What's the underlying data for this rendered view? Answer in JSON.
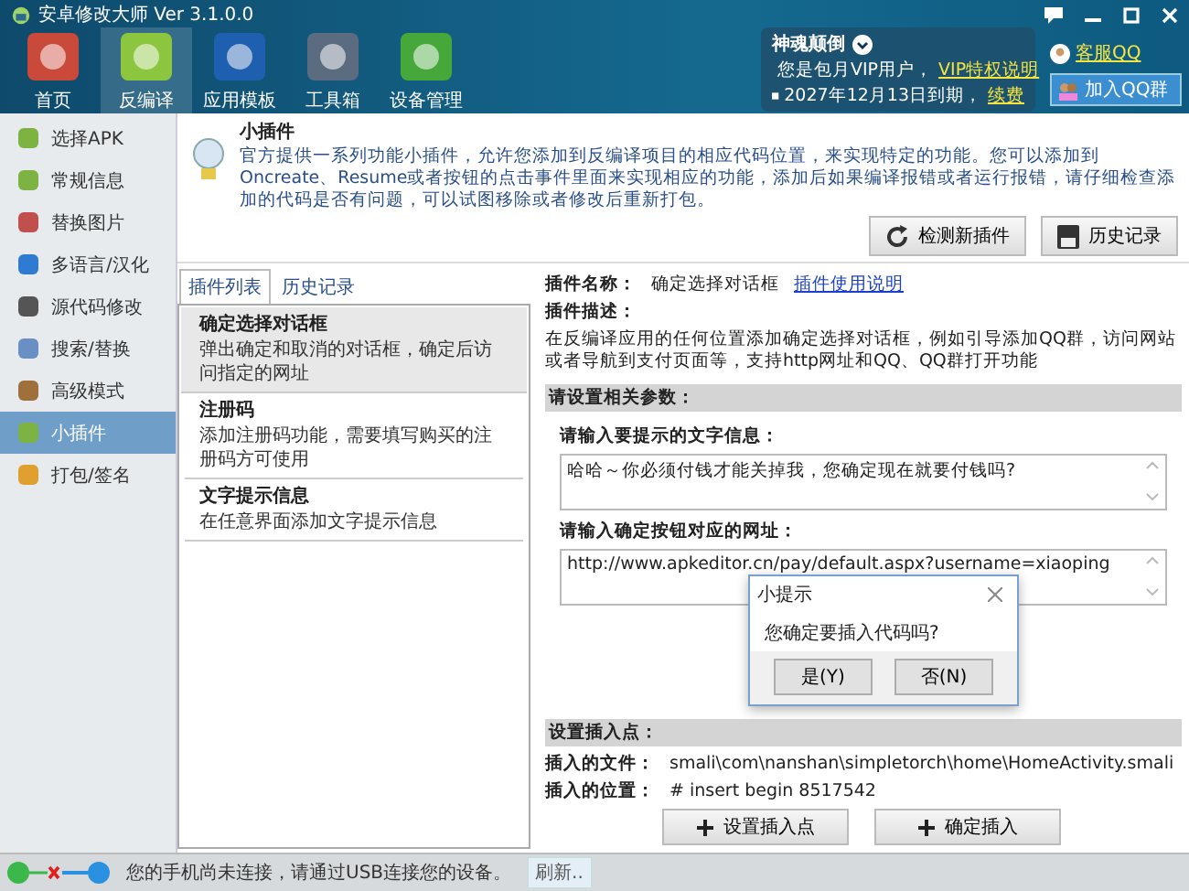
{
  "window": {
    "title": "安卓修改大师 Ver 3.1.0.0"
  },
  "toolbar": [
    {
      "label": "首页",
      "selected": false
    },
    {
      "label": "反编译",
      "selected": true
    },
    {
      "label": "应用模板",
      "selected": false
    },
    {
      "label": "工具箱",
      "selected": false
    },
    {
      "label": "设备管理",
      "selected": false
    }
  ],
  "account": {
    "name": "神魂颠倒",
    "line_1": "您是包月VIP用户，",
    "link_1": "VIP特权说明",
    "line_2": "2027年12月13日到期，",
    "link_2": "续费",
    "support_link": "客服QQ",
    "group_button": "加入QQ群"
  },
  "sidebar": [
    {
      "label": "选择APK",
      "selected": false
    },
    {
      "label": "常规信息",
      "selected": false
    },
    {
      "label": "替换图片",
      "selected": false
    },
    {
      "label": "多语言/汉化",
      "selected": false
    },
    {
      "label": "源代码修改",
      "selected": false
    },
    {
      "label": "搜索/替换",
      "selected": false
    },
    {
      "label": "高级模式",
      "selected": false
    },
    {
      "label": "小插件",
      "selected": true
    },
    {
      "label": "打包/签名",
      "selected": false
    }
  ],
  "header": {
    "title": "小插件",
    "description": "官方提供一系列功能小插件，允许您添加到反编译项目的相应代码位置，来实现特定的功能。您可以添加到Oncreate、Resume或者按钮的点击事件里面来实现相应的功能，添加后如果编译报错或者运行报错，请仔细检查添加的代码是否有问题，可以试图移除或者修改后重新打包。"
  },
  "actions": [
    "检测新插件",
    "历史记录"
  ],
  "tabs": [
    {
      "label": "插件列表",
      "selected": true
    },
    {
      "label": "历史记录",
      "selected": false
    }
  ],
  "plugins": [
    {
      "title": "确定选择对话框",
      "description": "弹出确定和取消的对话框，确定后访问指定的网址",
      "selected": true
    },
    {
      "title": "注册码",
      "description": "添加注册码功能，需要填写购买的注册码方可使用",
      "selected": false
    },
    {
      "title": "文字提示信息",
      "description": "在任意界面添加文字提示信息",
      "selected": false
    }
  ],
  "details": {
    "name_label": "插件名称：",
    "name": "确定选择对话框",
    "help_link": "插件使用说明",
    "description_label": "插件描述：",
    "description": "在反编译应用的任何位置添加确定选择对话框，例如引导添加QQ群，访问网站或者导航到支付页面等，支持http网址和QQ、QQ群打开功能",
    "params_heading": "请设置相关参数：",
    "fields": [
      {
        "label": "请输入要提示的文字信息：",
        "value": "哈哈～你必须付钱才能关掉我，您确定现在就要付钱吗?"
      },
      {
        "label": "请输入确定按钮对应的网址：",
        "value": "http://www.apkeditor.cn/pay/default.aspx?username=xiaoping"
      }
    ],
    "insert_heading": "设置插入点：",
    "file_label": "插入的文件：",
    "file": "smali\\com\\nanshan\\simpletorch\\home\\HomeActivity.smali",
    "position_label": "插入的位置：",
    "position": "# insert begin 8517542",
    "buttons": [
      "设置插入点",
      "确定插入"
    ]
  },
  "dialog": {
    "title": "小提示",
    "message": "您确定要插入代码吗?",
    "buttons": [
      "是(Y)",
      "否(N)"
    ]
  },
  "status_bar": {
    "message": "您的手机尚未连接，请通过USB连接您的设备。",
    "refresh": "刷新.."
  }
}
